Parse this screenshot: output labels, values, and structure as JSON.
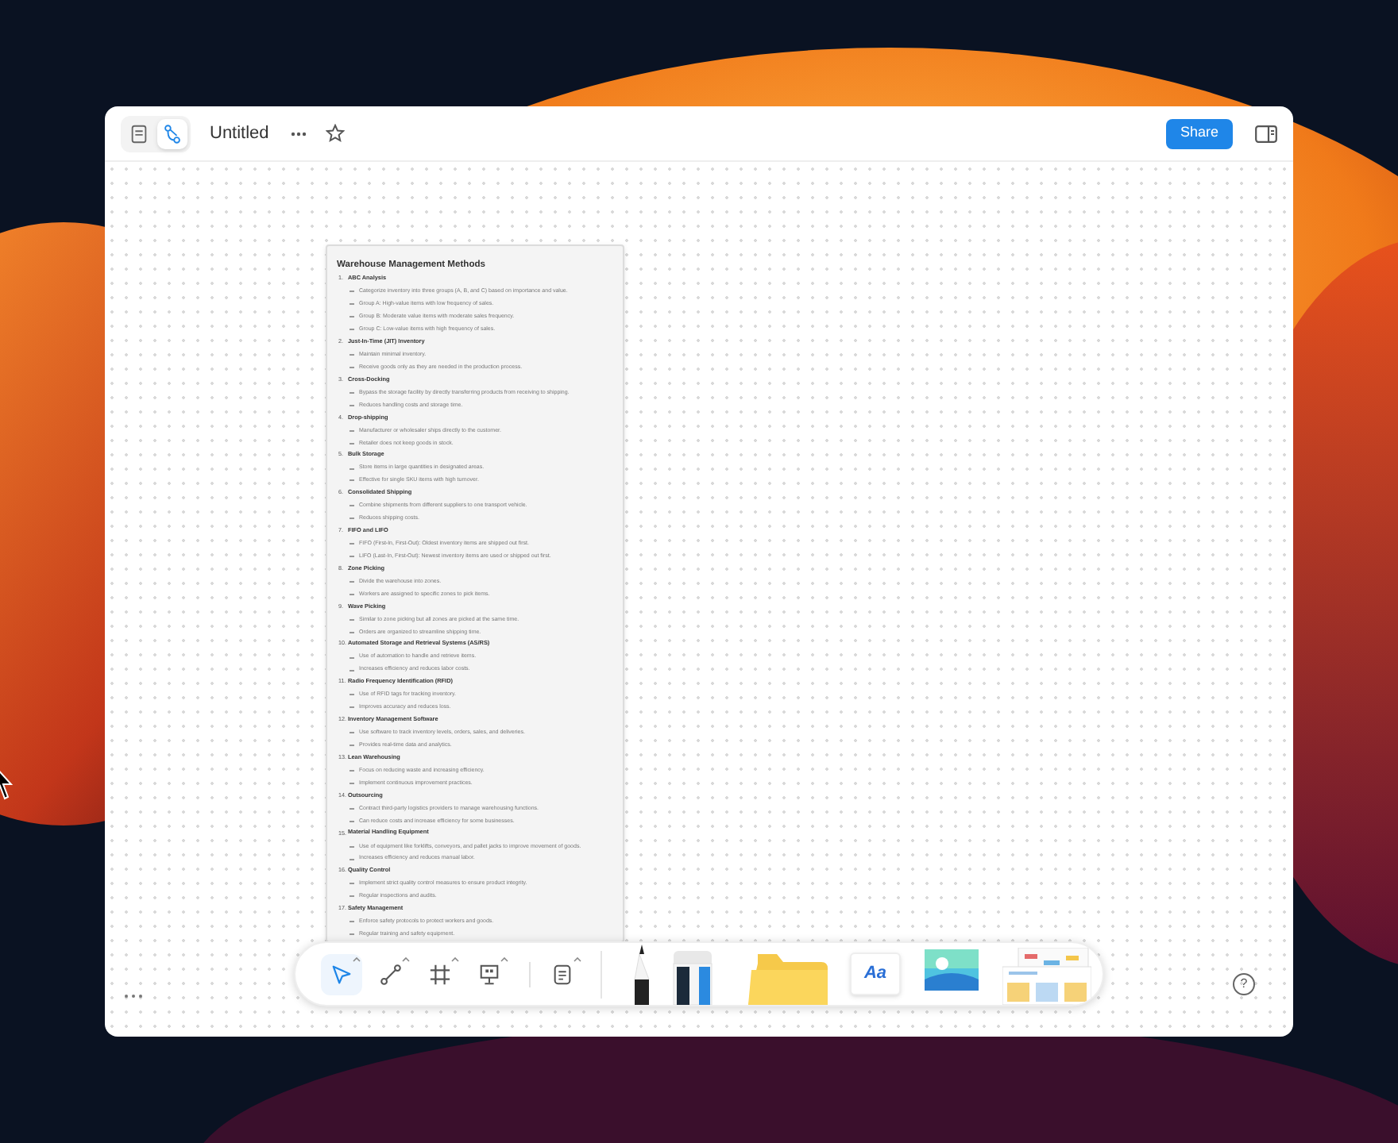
{
  "window": {
    "title": "Untitled",
    "share_label": "Share",
    "help_label": "?",
    "view_modes": [
      {
        "kind": "document",
        "selected": false
      },
      {
        "kind": "whiteboard",
        "selected": true
      }
    ]
  },
  "document": {
    "title": "Warehouse Management Methods",
    "sections": [
      {
        "number": "1.",
        "heading": "ABC Analysis",
        "children": [
          {
            "text": "Categorize inventory into three groups (A, B, and C) based on importance and value."
          },
          {
            "text": "Group A: High-value items with low frequency of sales."
          },
          {
            "text": "Group B: Moderate value items with moderate sales frequency."
          },
          {
            "text": "Group C: Low-value items with high frequency of sales."
          }
        ]
      },
      {
        "number": "2.",
        "heading": "Just-In-Time (JIT) Inventory",
        "children": [
          {
            "text": "Maintain minimal inventory."
          },
          {
            "text": "Receive goods only as they are needed in the production process."
          }
        ]
      },
      {
        "number": "3.",
        "heading": "Cross-Docking",
        "children": [
          {
            "text": "Bypass the storage facility by directly transferring products from receiving to shipping."
          },
          {
            "text": "Reduces handling costs and storage time."
          }
        ]
      },
      {
        "number": "4.",
        "heading": "Drop-shipping",
        "children": [
          {
            "text": "Manufacturer or wholesaler ships directly to the customer."
          },
          {
            "text": "Retailer does not keep goods in stock."
          }
        ]
      },
      {
        "number": "5.",
        "heading": "Bulk Storage",
        "children": [
          {
            "text": "Store items in large quantities in designated areas."
          },
          {
            "text": "Effective for single SKU items with high turnover."
          }
        ]
      },
      {
        "number": "6.",
        "heading": "Consolidated Shipping",
        "children": [
          {
            "text": "Combine shipments from different suppliers to one transport vehicle."
          },
          {
            "text": "Reduces shipping costs."
          }
        ]
      },
      {
        "number": "7.",
        "heading": "FIFO and LIFO",
        "children": [
          {
            "text": "FIFO (First-In, First-Out): Oldest inventory items are shipped out first."
          },
          {
            "text": "LIFO (Last-In, First-Out): Newest inventory items are used or shipped out first."
          }
        ]
      },
      {
        "number": "8.",
        "heading": "Zone Picking",
        "children": [
          {
            "text": "Divide the warehouse into zones."
          },
          {
            "text": "Workers are assigned to specific zones to pick items."
          }
        ]
      },
      {
        "number": "9.",
        "heading": "Wave Picking",
        "children": [
          {
            "text": "Similar to zone picking but all zones are picked at the same time."
          },
          {
            "text": "Orders are organized to streamline shipping time."
          }
        ]
      },
      {
        "number": "10.",
        "heading": "Automated Storage and Retrieval Systems (AS/RS)",
        "children": [
          {
            "text": "Use of automation to handle and retrieve items."
          },
          {
            "text": "Increases efficiency and reduces labor costs."
          }
        ]
      },
      {
        "number": "11.",
        "heading": "Radio Frequency Identification (RFID)",
        "children": [
          {
            "text": "Use of RFID tags for tracking inventory."
          },
          {
            "text": "Improves accuracy and reduces loss."
          }
        ]
      },
      {
        "number": "12.",
        "heading": "Inventory Management Software",
        "children": [
          {
            "text": "Use software to track inventory levels, orders, sales, and deliveries."
          },
          {
            "text": "Provides real-time data and analytics."
          }
        ]
      },
      {
        "number": "13.",
        "heading": "Lean Warehousing",
        "children": [
          {
            "text": "Focus on reducing waste and increasing efficiency."
          },
          {
            "text": "Implement continuous improvement practices."
          }
        ]
      },
      {
        "number": "14.",
        "heading": "Outsourcing",
        "children": [
          {
            "text": "Contract third-party logistics providers to manage warehousing functions."
          },
          {
            "text": "Can reduce costs and increase efficiency for some businesses."
          }
        ]
      },
      {
        "number": "15.",
        "heading": "Material Handling Equipment",
        "children": [
          {
            "text": "Use of equipment like forklifts, conveyors, and pallet jacks to improve movement of goods."
          },
          {
            "text": "Increases efficiency and reduces manual labor."
          }
        ]
      },
      {
        "number": "16.",
        "heading": "Quality Control",
        "children": [
          {
            "text": "Implement strict quality control measures to ensure product integrity."
          },
          {
            "text": "Regular inspections and audits."
          }
        ]
      },
      {
        "number": "17.",
        "heading": "Safety Management",
        "children": [
          {
            "text": "Enforce safety protocols to protect workers and goods."
          },
          {
            "text": "Regular training and safety equipment."
          }
        ]
      }
    ]
  },
  "toolbar": {
    "tools": [
      {
        "kind": "select",
        "selected": true
      },
      {
        "kind": "connector",
        "selected": false
      },
      {
        "kind": "frame",
        "selected": false
      },
      {
        "kind": "presentation",
        "selected": false
      },
      {
        "kind": "document",
        "selected": false
      }
    ],
    "assets": [
      {
        "kind": "pencil"
      },
      {
        "kind": "marker"
      },
      {
        "kind": "folder"
      },
      {
        "kind": "text",
        "label": "Aa"
      },
      {
        "kind": "image"
      },
      {
        "kind": "templates"
      }
    ]
  }
}
